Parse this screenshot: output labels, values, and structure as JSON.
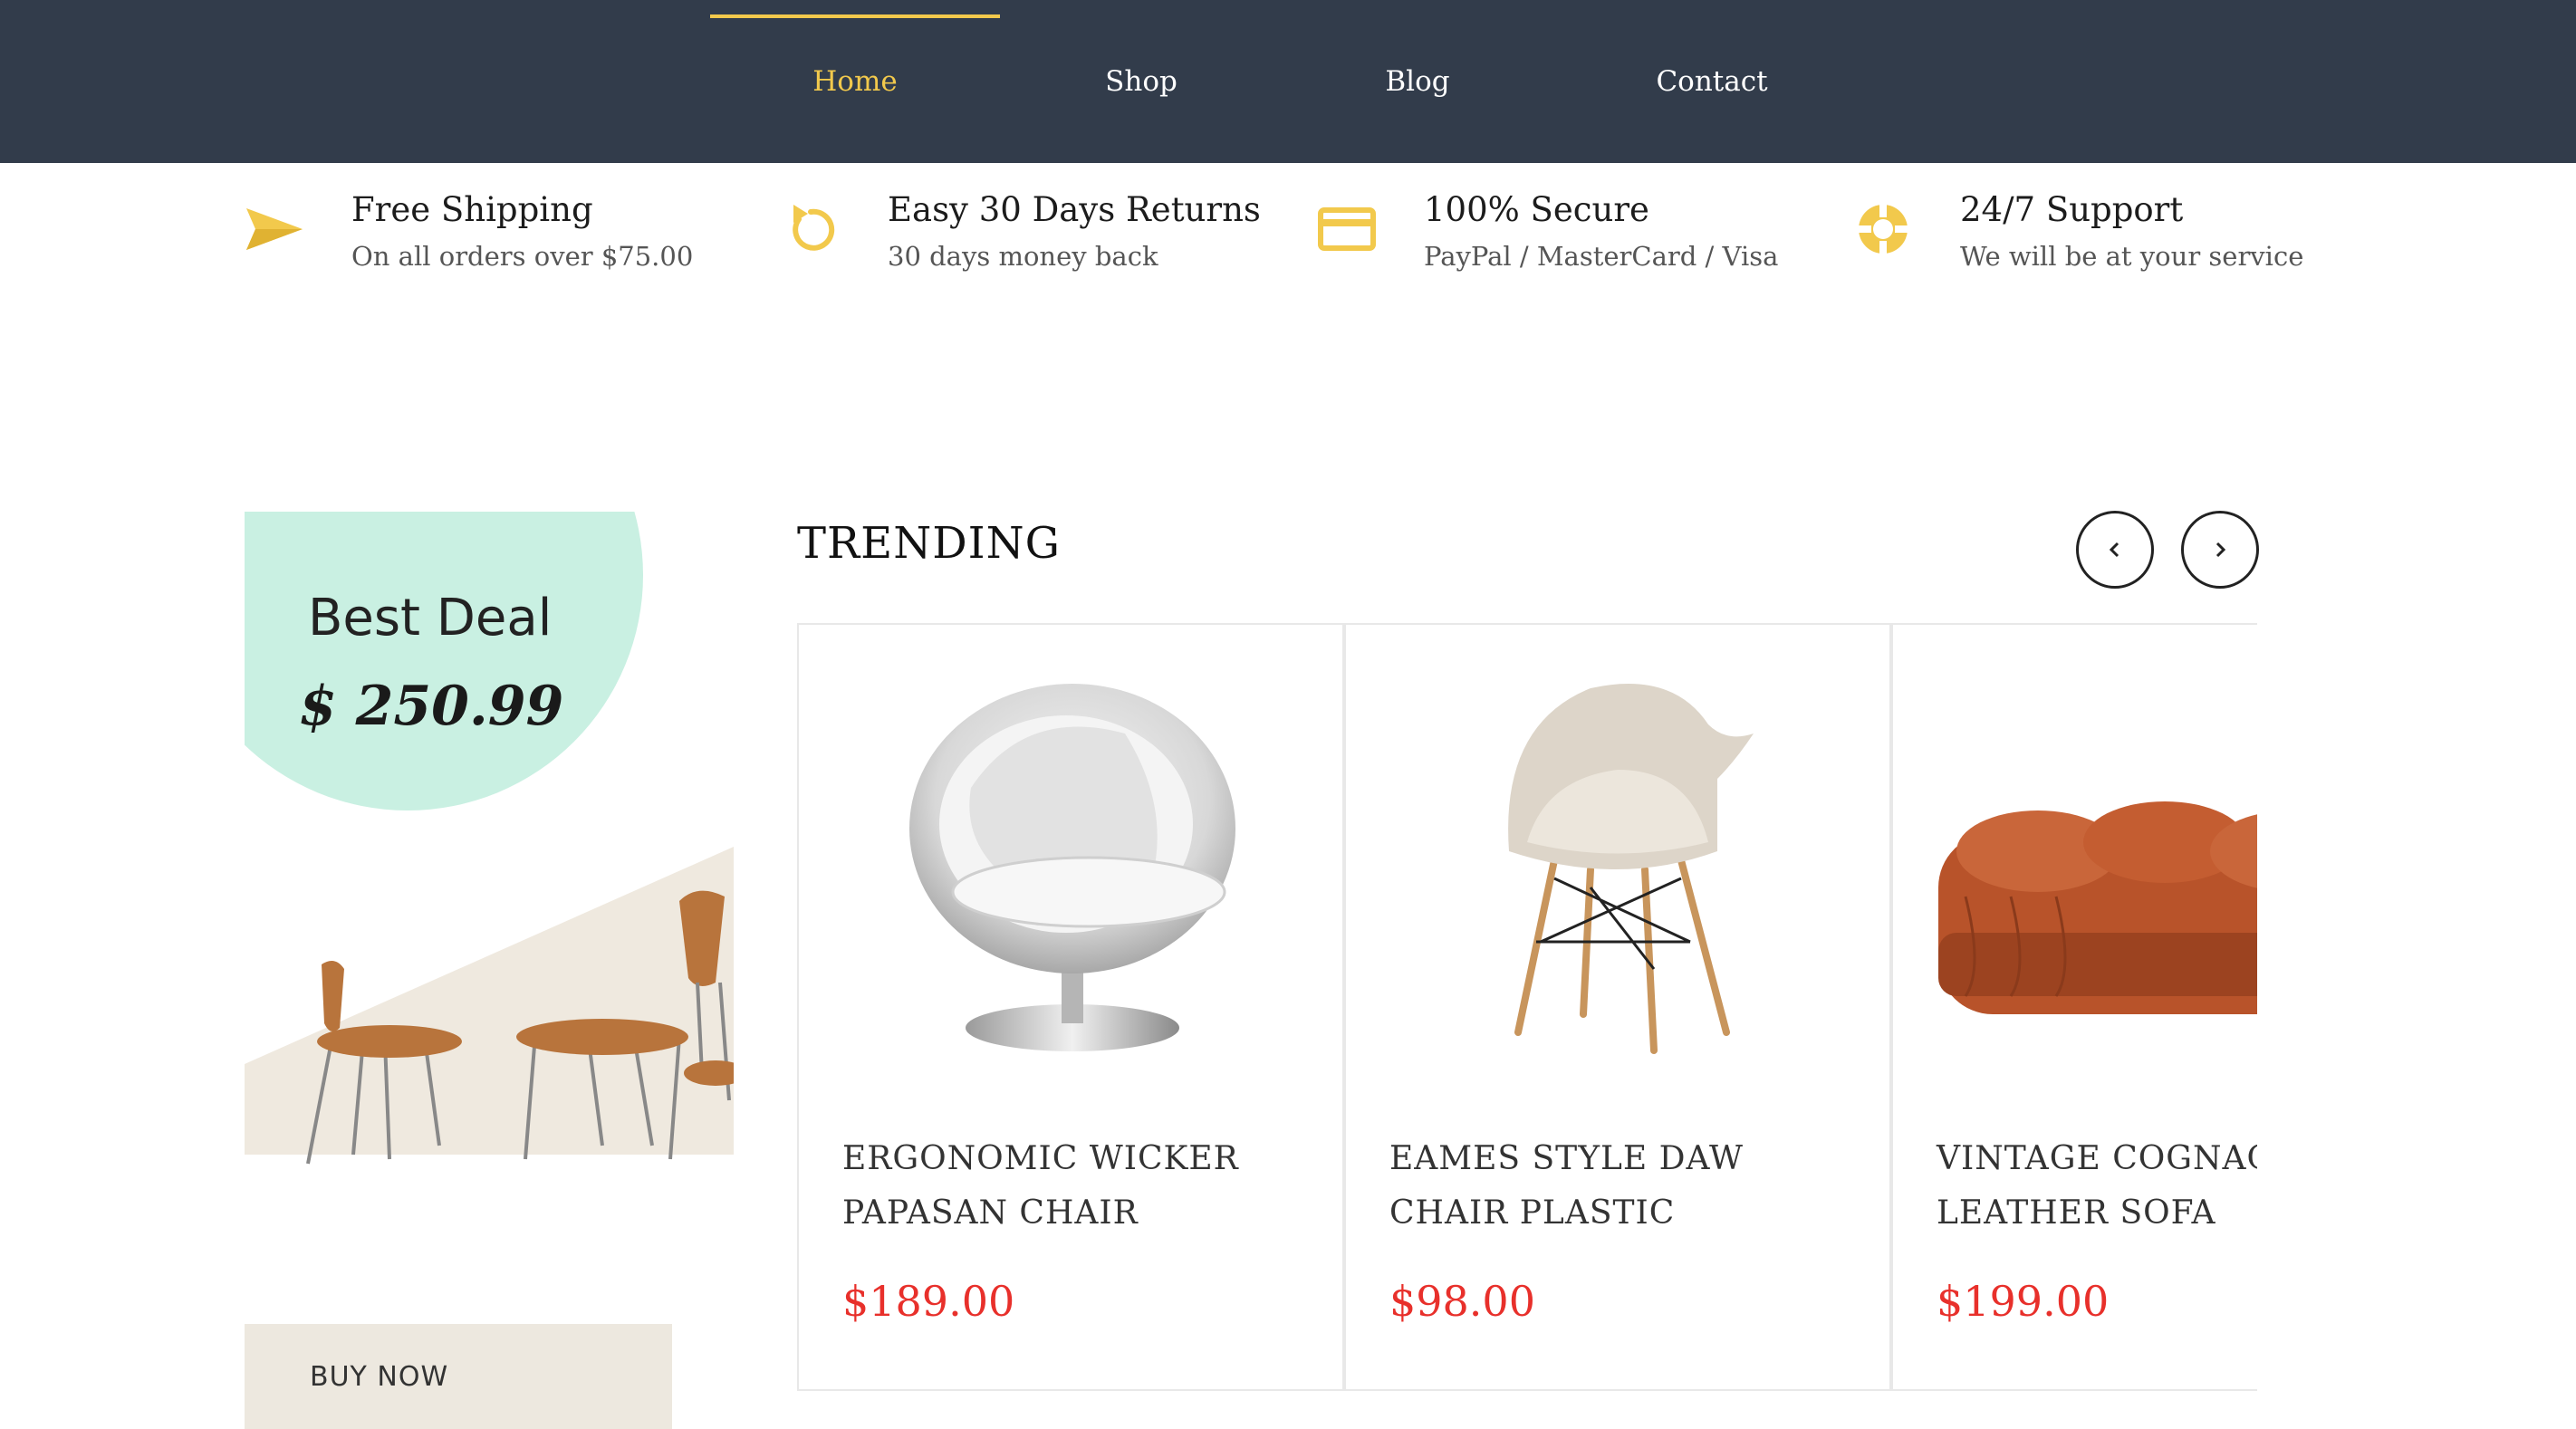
{
  "nav": {
    "items": [
      {
        "label": "Home",
        "active": true
      },
      {
        "label": "Shop"
      },
      {
        "label": "Blog"
      },
      {
        "label": "Contact"
      }
    ]
  },
  "features": [
    {
      "icon": "paper-plane-icon",
      "title": "Free Shipping",
      "subtitle": "On all orders over $75.00"
    },
    {
      "icon": "refresh-icon",
      "title": "Easy 30 Days Returns",
      "subtitle": "30 days money back"
    },
    {
      "icon": "credit-card-icon",
      "title": "100% Secure",
      "subtitle": "PayPal / MasterCard / Visa"
    },
    {
      "icon": "lifebuoy-icon",
      "title": "24/7 Support",
      "subtitle": "We will be at your service"
    }
  ],
  "promo": {
    "title": "Best Deal",
    "price": "$ 250.99",
    "button_label": "BUY NOW"
  },
  "trending": {
    "title": "TRENDING",
    "products": [
      {
        "name": "ERGONOMIC WICKER PAPASAN CHAIR",
        "price": "$189.00"
      },
      {
        "name": "EAMES STYLE DAW CHAIR PLASTIC",
        "price": "$98.00"
      },
      {
        "name": "VINTAGE COGNAC LEATHER SOFA",
        "price": "$199.00"
      }
    ]
  },
  "colors": {
    "nav_bg": "#323c4b",
    "accent": "#f2c94c",
    "price": "#e8302b",
    "promo_mint": "#c9f0e2"
  }
}
